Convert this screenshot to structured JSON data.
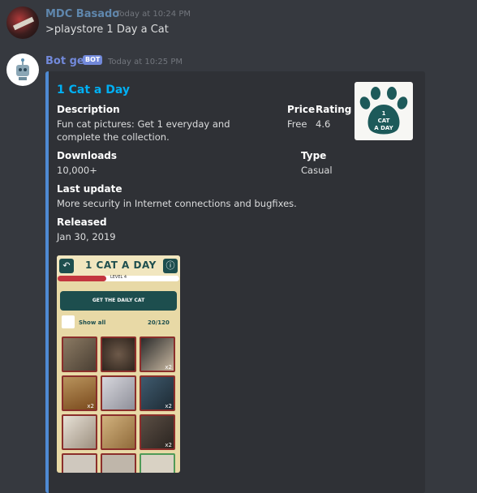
{
  "messages": [
    {
      "username": "MDC Basado",
      "username_color": "#5f87ad",
      "timestamp": "Today at 10:24 PM",
      "content": ">playstore 1 Day a Cat"
    },
    {
      "username": "Bot gei",
      "username_color": "#7289da",
      "bot_tag": "BOT",
      "timestamp": "Today at 10:25 PM"
    }
  ],
  "embed": {
    "title": "1 Cat a Day",
    "accent_color": "#4f8ad3",
    "thumbnail": {
      "line1": "1",
      "line2": "CAT",
      "line3": "A DAY"
    },
    "fields": {
      "description_name": "Description",
      "description_value": "Fun cat pictures: Get 1 everyday and complete the collection.",
      "price_name": "Price",
      "price_value": "Free",
      "rating_name": "Rating",
      "rating_value": "4.6",
      "downloads_name": "Downloads",
      "downloads_value": "10,000+",
      "type_name": "Type",
      "type_value": "Casual",
      "last_update_name": "Last update",
      "last_update_value": "More security in Internet connections and bugfixes.",
      "released_name": "Released",
      "released_value": "Jan 30, 2019"
    },
    "screenshot": {
      "title": "1 CAT A DAY",
      "back_icon": "back-arrow-icon",
      "info_icon": "info-icon",
      "level_text": "LEVEL 4",
      "level_progress": 0.4,
      "button": "GET THE DAILY CAT",
      "show_all": "Show all",
      "count": "20/120",
      "badges": [
        "x2",
        "x2",
        "x2",
        "x2"
      ]
    }
  }
}
